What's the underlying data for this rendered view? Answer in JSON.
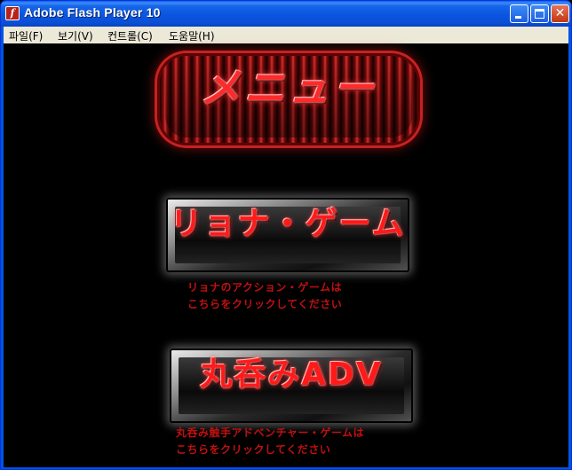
{
  "window": {
    "title": "Adobe Flash Player 10",
    "icon_glyph": "f"
  },
  "menubar": {
    "items": [
      "파일(F)",
      "보기(V)",
      "컨트롤(C)",
      "도움말(H)"
    ]
  },
  "stage": {
    "menu_title": "メニュー",
    "buttons": [
      {
        "label": "リョナ・ゲーム",
        "desc_line1": "リョナのアクション・ゲームは",
        "desc_line2": "こちらをクリックしてください"
      },
      {
        "label": "丸呑みADV",
        "desc_line1": "丸呑み触手アドベンチャー・ゲームは",
        "desc_line2": "こちらをクリックしてください"
      }
    ]
  },
  "colors": {
    "titlebar": "#0a55e0",
    "menubar": "#ece9d8",
    "stage_bg": "#000000",
    "accent_red": "#ff1a1a",
    "desc_red": "#c01010"
  }
}
